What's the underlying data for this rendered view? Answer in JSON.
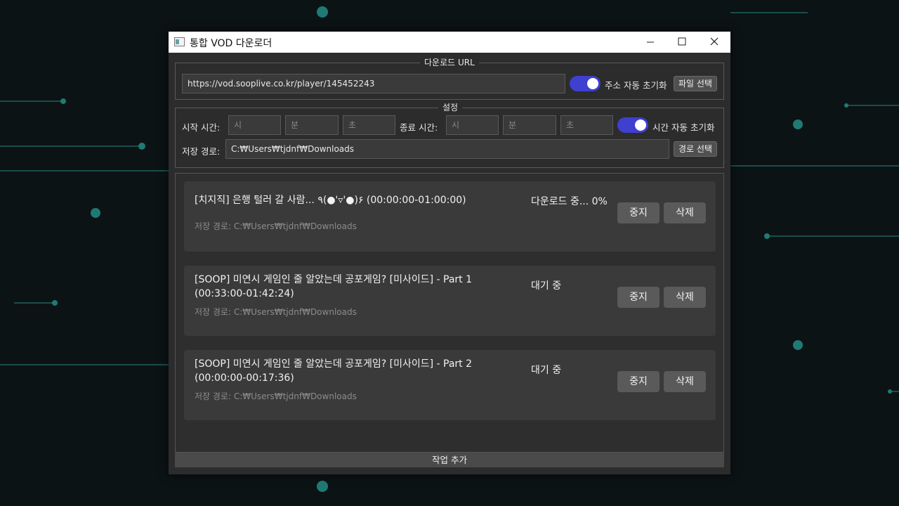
{
  "window": {
    "title": "통합 VOD 다운로더"
  },
  "url_group": {
    "title": "다운로드 URL",
    "url_value": "https://vod.sooplive.co.kr/player/145452243",
    "auto_clear_label": "주소 자동 초기화",
    "auto_clear_on": true,
    "file_select_label": "파일 선택"
  },
  "settings_group": {
    "title": "설정",
    "start_label": "시작 시간:",
    "end_label": "종료 시간:",
    "placeholders": {
      "hour": "시",
      "minute": "분",
      "second": "초"
    },
    "time_auto_clear_label": "시간 자동 초기화",
    "time_auto_clear_on": true,
    "save_path_label": "저장 경로:",
    "save_path_value": "C:₩Users₩tjdnf₩Downloads",
    "path_select_label": "경로 선택"
  },
  "jobs": [
    {
      "title": "[치지직] 은행 털러 갈 사람... ٩(●'▿'●)۶ (00:00:00-01:00:00)",
      "path": "저장 경로: C:₩Users₩tjdnf₩Downloads",
      "status": "다운로드 중... 0%",
      "stop_label": "중지",
      "delete_label": "삭제"
    },
    {
      "title": "[SOOP] 미연시 게임인 줄 알았는데 공포게임? [미사이드] - Part 1 (00:33:00-01:42:24)",
      "path": "저장 경로: C:₩Users₩tjdnf₩Downloads",
      "status": "대기 중",
      "stop_label": "중지",
      "delete_label": "삭제"
    },
    {
      "title": "[SOOP] 미연시 게임인 줄 알았는데 공포게임? [미사이드] - Part 2 (00:00:00-00:17:36)",
      "path": "저장 경로: C:₩Users₩tjdnf₩Downloads",
      "status": "대기 중",
      "stop_label": "중지",
      "delete_label": "삭제"
    }
  ],
  "add_job_label": "작업 추가",
  "colors": {
    "accent_toggle": "#3f3fd0",
    "desktop_bg": "#0d1416",
    "circuit_line": "#1f6e6a"
  }
}
